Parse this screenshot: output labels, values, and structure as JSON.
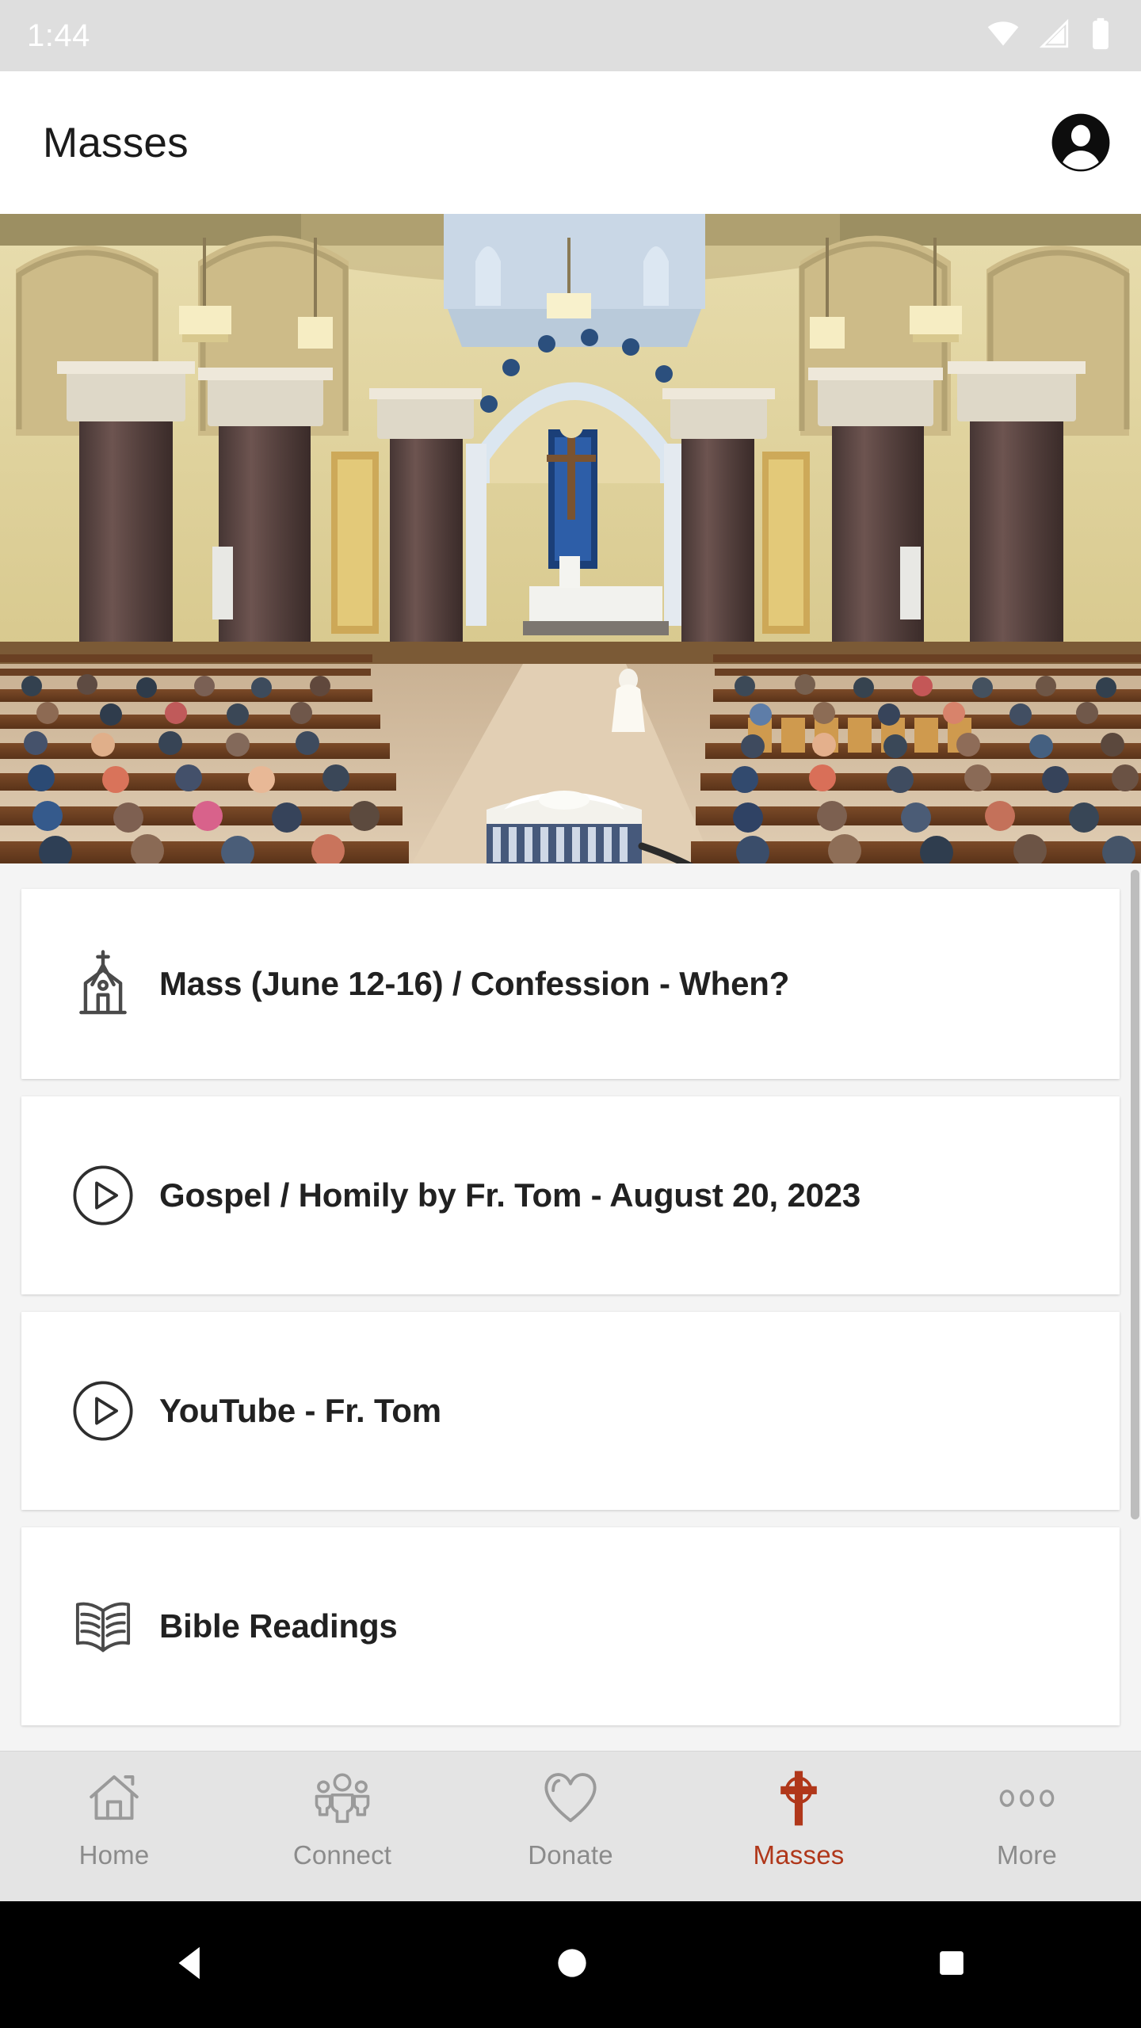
{
  "status_bar": {
    "time": "1:44",
    "icons": [
      "wifi-icon",
      "cellular-signal-icon",
      "battery-icon"
    ],
    "background_color": "#dedede",
    "foreground_color": "#ffffff"
  },
  "app_bar": {
    "title": "Masses",
    "avatar_icon": "account-avatar-icon",
    "background_color": "#ffffff"
  },
  "hero": {
    "alt": "church-interior-photo",
    "description": "Interior of a Catholic church during Mass with marble columns, arches, chandeliers, altar with blue canopy, and congregation seated in wooden pews"
  },
  "list": {
    "items": [
      {
        "icon": "church-icon",
        "label": "Mass (June 12-16) / Confession - When?"
      },
      {
        "icon": "play-circle-icon",
        "label": "Gospel / Homily by Fr. Tom - August 20, 2023"
      },
      {
        "icon": "play-circle-icon",
        "label": "YouTube - Fr. Tom"
      },
      {
        "icon": "open-book-icon",
        "label": "Bible Readings"
      }
    ],
    "background_color": "#f4f4f4",
    "card_color": "#ffffff",
    "scrollbar_color": "#bdbdbd"
  },
  "bottom_nav": {
    "active_color": "#b0371a",
    "inactive_color": "#8b8b8b",
    "background_color": "#e4e4e4",
    "items": [
      {
        "label": "Home",
        "icon": "home-icon",
        "active": false
      },
      {
        "label": "Connect",
        "icon": "people-icon",
        "active": false
      },
      {
        "label": "Donate",
        "icon": "heart-icon",
        "active": false
      },
      {
        "label": "Masses",
        "icon": "cross-icon",
        "active": true
      },
      {
        "label": "More",
        "icon": "ellipsis-icon",
        "active": false
      }
    ]
  },
  "android_nav": {
    "back": "back-triangle-icon",
    "home": "home-circle-icon",
    "recents": "recents-square-icon",
    "background_color": "#000000"
  }
}
